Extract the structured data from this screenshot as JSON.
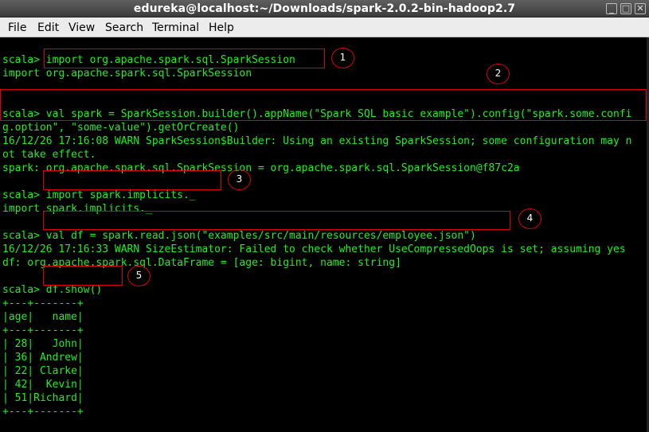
{
  "window": {
    "title": "edureka@localhost:~/Downloads/spark-2.0.2-bin-hadoop2.7",
    "controls": {
      "minimize": "_",
      "maximize": "□",
      "close": "✕"
    }
  },
  "menu": {
    "items": [
      "File",
      "Edit",
      "View",
      "Search",
      "Terminal",
      "Help"
    ]
  },
  "terminal": {
    "lines": [
      "scala> import org.apache.spark.sql.SparkSession",
      "import org.apache.spark.sql.SparkSession",
      "",
      "",
      "scala> val spark = SparkSession.builder().appName(\"Spark SQL basic example\").config(\"spark.some.confi",
      "g.option\", \"some-value\").getOrCreate()",
      "16/12/26 17:16:08 WARN SparkSession$Builder: Using an existing SparkSession; some configuration may n",
      "ot take effect.",
      "spark: org.apache.spark.sql.SparkSession = org.apache.spark.sql.SparkSession@f87c2a",
      "",
      "scala> import spark.implicits._",
      "import spark.implicits._",
      "",
      "scala> val df = spark.read.json(\"examples/src/main/resources/employee.json\")",
      "16/12/26 17:16:33 WARN SizeEstimator: Failed to check whether UseCompressedOops is set; assuming yes",
      "df: org.apache.spark.sql.DataFrame = [age: bigint, name: string]",
      "",
      "scala> df.show()",
      "+---+-------+",
      "|age|   name|",
      "+---+-------+",
      "| 28|   John|",
      "| 36| Andrew|",
      "| 22| Clarke|",
      "| 42|  Kevin|",
      "| 51|Richard|",
      "+---+-------+"
    ]
  },
  "annotations": {
    "callouts": [
      "1",
      "2",
      "3",
      "4",
      "5"
    ]
  },
  "colors": {
    "terminal_text": "#1ff01f",
    "terminal_bg": "#000000",
    "annotation": "#dd0000"
  }
}
